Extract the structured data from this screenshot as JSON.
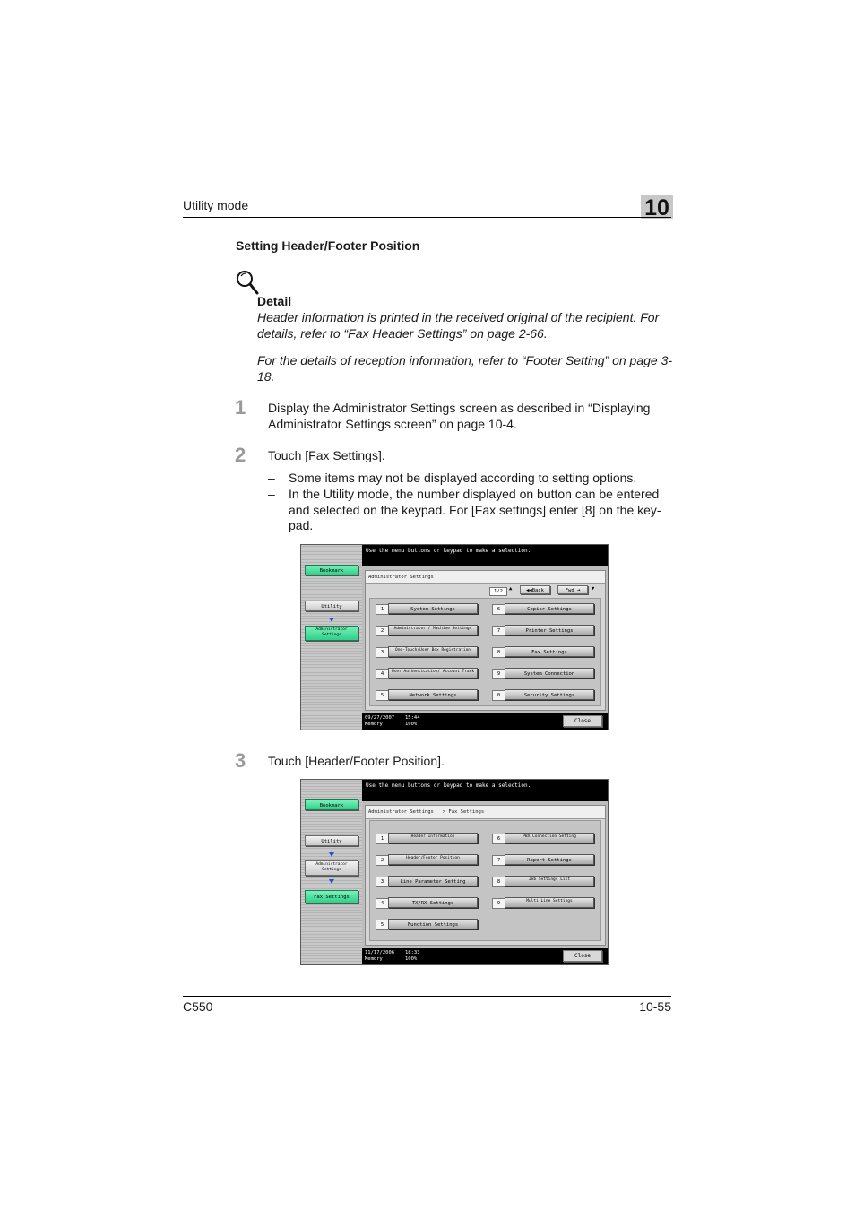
{
  "header": {
    "section": "Utility mode",
    "chapter": "10"
  },
  "title": "Setting Header/Footer Position",
  "detail": {
    "label": "Detail",
    "para1": "Header information is printed in the received original of the recipient. For details, refer to “Fax Header Settings” on page 2-66.",
    "para2": "For the details of reception information, refer to “Footer Setting” on page 3-18."
  },
  "steps": [
    {
      "num": "1",
      "text": "Display the Administrator Settings screen as described in “Displaying Administrator Settings screen” on page 10-4."
    },
    {
      "num": "2",
      "text": "Touch [Fax Settings].",
      "bullets": [
        "Some items may not be displayed according to setting options.",
        "In the Utility mode, the number displayed on button can be entered and selected on the keypad. For [Fax settings] enter [8] on the key-pad."
      ]
    },
    {
      "num": "3",
      "text": "Touch [Header/Footer Position]."
    }
  ],
  "screen1": {
    "message": "Use the menu buttons or keypad to make a selection.",
    "bookmark": "Bookmark",
    "utility": "Utility",
    "admin": "Administrator Settings",
    "crumb": "Administrator Settings",
    "page": "1/2",
    "back": "Back",
    "forward": "Fwd",
    "items": [
      {
        "num": "1",
        "label": "System Settings"
      },
      {
        "num": "2",
        "label": "Administrator / Machine Settings"
      },
      {
        "num": "3",
        "label": "One-Touch/User Box Registration"
      },
      {
        "num": "4",
        "label": "User Authentication/ Account Track"
      },
      {
        "num": "5",
        "label": "Network Settings"
      },
      {
        "num": "6",
        "label": "Copier Settings"
      },
      {
        "num": "7",
        "label": "Printer Settings"
      },
      {
        "num": "8",
        "label": "Fax Settings"
      },
      {
        "num": "9",
        "label": "System Connection"
      },
      {
        "num": "0",
        "label": "Security Settings"
      }
    ],
    "date": "09/27/2007",
    "time": "15:44",
    "memory_label": "Memory",
    "memory": "100%",
    "close": "Close"
  },
  "screen2": {
    "message": "Use the menu buttons or keypad to make a selection.",
    "bookmark": "Bookmark",
    "utility": "Utility",
    "admin": "Administrator Settings",
    "fax": "Fax Settings",
    "crumb": "Administrator Settings   > Fax Settings",
    "items": [
      {
        "num": "1",
        "label": "Header Information"
      },
      {
        "num": "2",
        "label": "Header/Footer Position"
      },
      {
        "num": "3",
        "label": "Line Parameter Setting"
      },
      {
        "num": "4",
        "label": "TX/RX Settings"
      },
      {
        "num": "5",
        "label": "Function Settings"
      },
      {
        "num": "6",
        "label": "PBX Connection Setting"
      },
      {
        "num": "7",
        "label": "Report Settings"
      },
      {
        "num": "8",
        "label": "Job Settings List"
      },
      {
        "num": "9",
        "label": "Multi Line Settings"
      }
    ],
    "date": "11/17/2006",
    "time": "18:33",
    "memory_label": "Memory",
    "memory": "100%",
    "close": "Close"
  },
  "footer": {
    "model": "C550",
    "page": "10-55"
  }
}
